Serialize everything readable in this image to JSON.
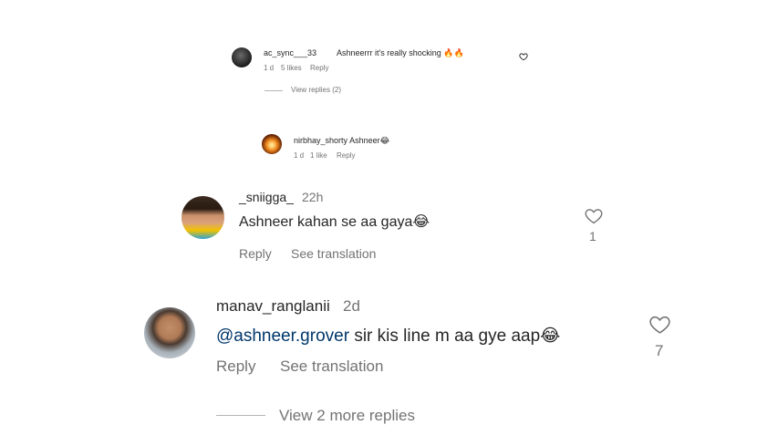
{
  "comments": [
    {
      "username": "ac_sync___33",
      "text": "Ashneerrr it's really shocking 🔥🔥",
      "time": "1 d",
      "likes": "5 likes",
      "reply": "Reply",
      "view_replies": "View replies (2)"
    },
    {
      "username": "nirbhay_shorty",
      "text": "Ashneer😂",
      "time": "1 d",
      "likes": "1 like",
      "reply": "Reply"
    },
    {
      "username": "_sniigga_",
      "time": "22h",
      "text": "Ashneer kahan se aa gaya😂",
      "reply": "Reply",
      "see_translation": "See translation",
      "like_count": "1"
    },
    {
      "username": "manav_ranglanii",
      "time": "2d",
      "mention": "@ashneer.grover",
      "text": " sir kis line m aa gye aap😂",
      "reply": "Reply",
      "see_translation": "See translation",
      "like_count": "7",
      "view_more": "View 2 more replies"
    }
  ],
  "colors": {
    "mention": "#00376b",
    "muted": "#737373",
    "text": "#262626"
  }
}
